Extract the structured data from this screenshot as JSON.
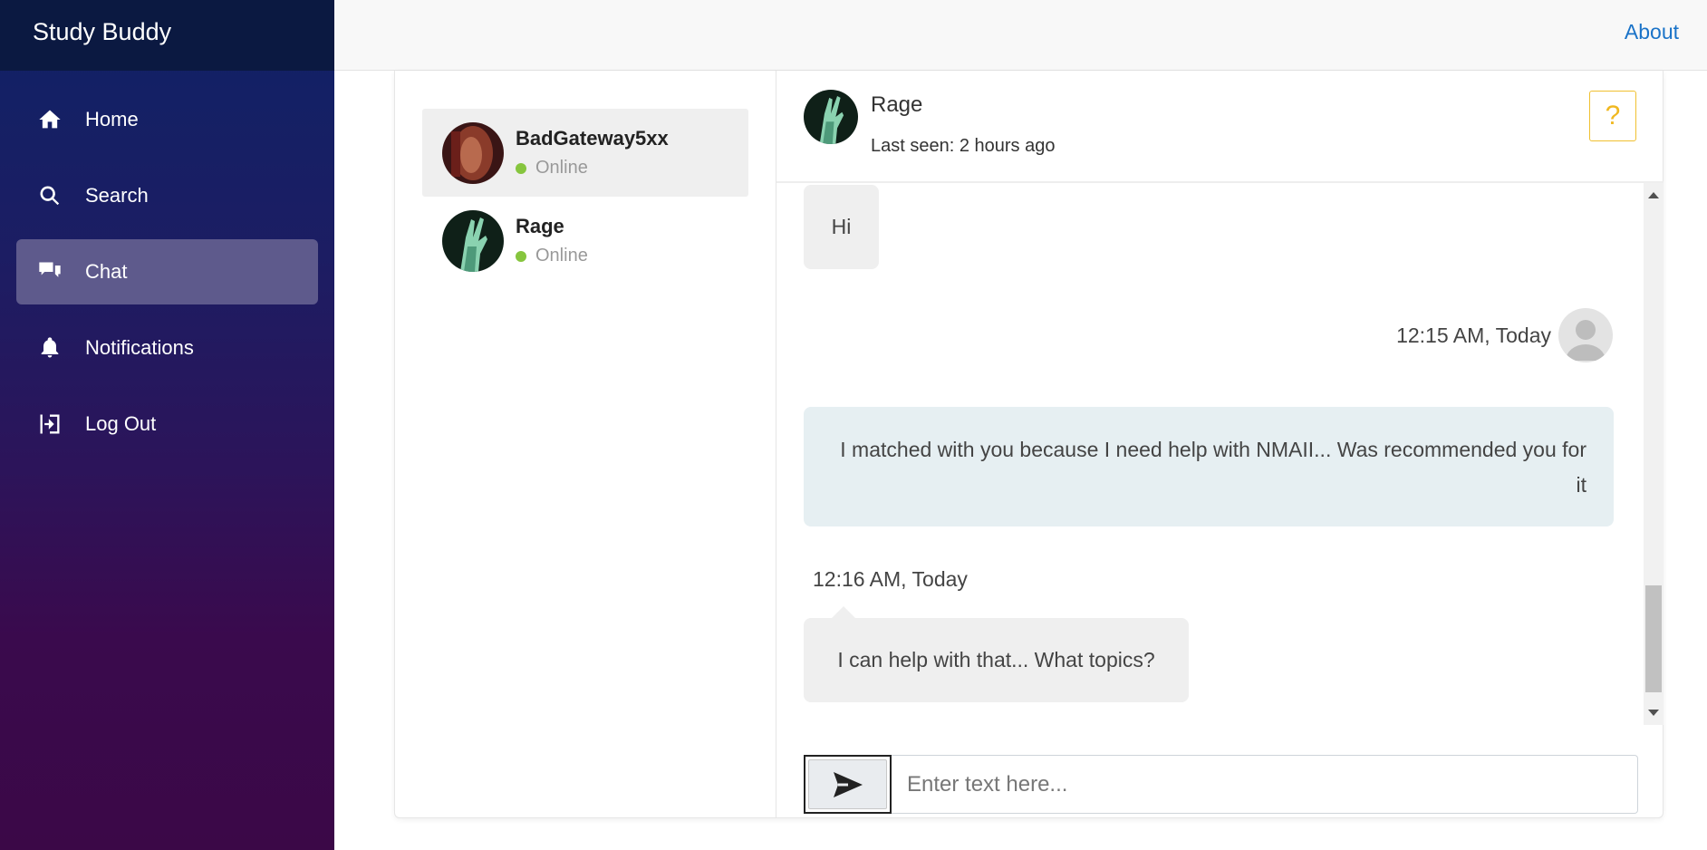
{
  "app": {
    "brand": "Study Buddy"
  },
  "sidebar": {
    "items": [
      {
        "label": "Home",
        "icon": "home-icon"
      },
      {
        "label": "Search",
        "icon": "search-icon"
      },
      {
        "label": "Chat",
        "icon": "chat-icon",
        "active": true
      },
      {
        "label": "Notifications",
        "icon": "bell-icon"
      },
      {
        "label": "Log Out",
        "icon": "logout-icon"
      }
    ]
  },
  "topbar": {
    "about_label": "About"
  },
  "contacts": [
    {
      "name": "BadGateway5xx",
      "status": "Online",
      "selected": true
    },
    {
      "name": "Rage",
      "status": "Online",
      "selected": false
    }
  ],
  "chat": {
    "header": {
      "name": "Rage",
      "last_seen": "Last seen: 2 hours ago",
      "help_label": "?"
    },
    "messages": [
      {
        "text": "Hi",
        "side": "left"
      },
      {
        "timestamp": "12:15 AM, Today",
        "side": "right"
      },
      {
        "text": "I matched with you because I need help with NMAII... Was recommended you for it",
        "side": "right"
      },
      {
        "timestamp": "12:16 AM, Today",
        "side": "left"
      },
      {
        "text": "I can help with that... What topics?",
        "side": "left"
      }
    ],
    "input": {
      "placeholder": "Enter text here..."
    }
  },
  "colors": {
    "sidebar_top": "#0f2266",
    "sidebar_bottom": "#3b0847",
    "active_nav": "#5e5a8c",
    "accent_link": "#1a73c8",
    "online": "#86c53e",
    "sent_bubble": "#e6eff2",
    "received_bubble": "#efefef",
    "help_button": "#f0b820"
  }
}
